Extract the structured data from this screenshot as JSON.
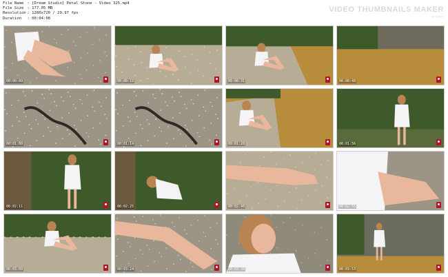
{
  "header": {
    "meta": [
      {
        "key": "File Name",
        "value": "[Dream Studio] Petal Stone - Video 325.mp4"
      },
      {
        "key": "File Size",
        "value": "177.05 MB"
      },
      {
        "key": "Resolution",
        "value": "1280x720 / 29.97 fps"
      },
      {
        "key": "Duration",
        "value": "00:04:08"
      }
    ],
    "logo_text": "VIDEO THUMBNAILS MAKER",
    "logo_subtext": "by Viewer"
  },
  "thumbnails": [
    {
      "time": "00:00:09",
      "scene": "sitting-close"
    },
    {
      "time": "00:00:19",
      "scene": "sitting-rocks"
    },
    {
      "time": "00:00:31",
      "scene": "sitting-water"
    },
    {
      "time": "00:00:48",
      "scene": "water-only"
    },
    {
      "time": "00:01:00",
      "scene": "snake"
    },
    {
      "time": "00:01:14",
      "scene": "snake"
    },
    {
      "time": "00:01:28",
      "scene": "sitting-water2"
    },
    {
      "time": "00:01:56",
      "scene": "standing-bush"
    },
    {
      "time": "00:02:11",
      "scene": "bush-back"
    },
    {
      "time": "00:02:25",
      "scene": "bending"
    },
    {
      "time": "00:02:40",
      "scene": "foot-sand"
    },
    {
      "time": "00:02:55",
      "scene": "sitting-closeup"
    },
    {
      "time": "00:03:09",
      "scene": "squat-front"
    },
    {
      "time": "00:03:24",
      "scene": "leg-gravel"
    },
    {
      "time": "00:03:38",
      "scene": "face-close"
    },
    {
      "time": "00:03:53",
      "scene": "walking-water"
    }
  ],
  "colors": {
    "gravel": "#9c9484",
    "sand": "#b7ac96",
    "foliage": "#3f5a2a",
    "water": "#b78d3c",
    "shirt": "#f4f4f6",
    "skin": "#e8b79c",
    "hair": "#b88452",
    "badge": "#b3122a"
  }
}
